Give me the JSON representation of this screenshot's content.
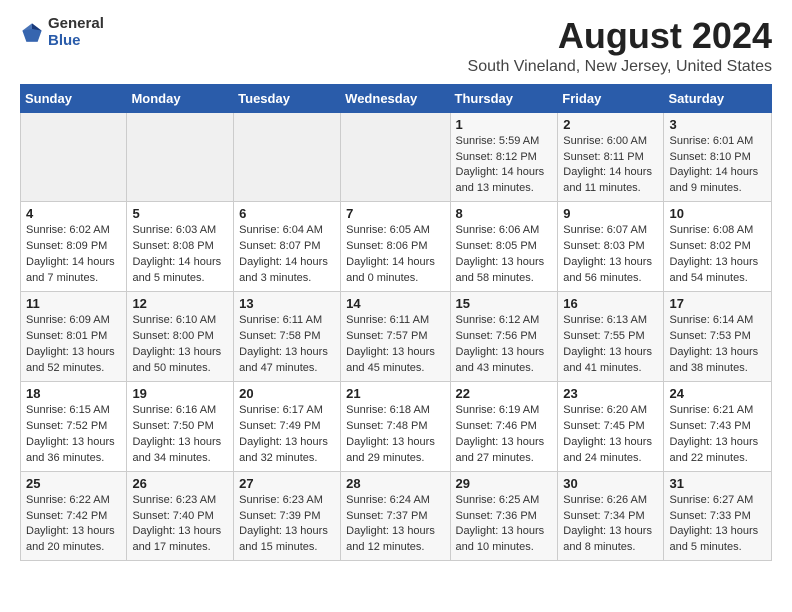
{
  "logo": {
    "general": "General",
    "blue": "Blue"
  },
  "title": "August 2024",
  "subtitle": "South Vineland, New Jersey, United States",
  "days_header": [
    "Sunday",
    "Monday",
    "Tuesday",
    "Wednesday",
    "Thursday",
    "Friday",
    "Saturday"
  ],
  "weeks": [
    [
      {
        "day": "",
        "info": ""
      },
      {
        "day": "",
        "info": ""
      },
      {
        "day": "",
        "info": ""
      },
      {
        "day": "",
        "info": ""
      },
      {
        "day": "1",
        "info": "Sunrise: 5:59 AM\nSunset: 8:12 PM\nDaylight: 14 hours\nand 13 minutes."
      },
      {
        "day": "2",
        "info": "Sunrise: 6:00 AM\nSunset: 8:11 PM\nDaylight: 14 hours\nand 11 minutes."
      },
      {
        "day": "3",
        "info": "Sunrise: 6:01 AM\nSunset: 8:10 PM\nDaylight: 14 hours\nand 9 minutes."
      }
    ],
    [
      {
        "day": "4",
        "info": "Sunrise: 6:02 AM\nSunset: 8:09 PM\nDaylight: 14 hours\nand 7 minutes."
      },
      {
        "day": "5",
        "info": "Sunrise: 6:03 AM\nSunset: 8:08 PM\nDaylight: 14 hours\nand 5 minutes."
      },
      {
        "day": "6",
        "info": "Sunrise: 6:04 AM\nSunset: 8:07 PM\nDaylight: 14 hours\nand 3 minutes."
      },
      {
        "day": "7",
        "info": "Sunrise: 6:05 AM\nSunset: 8:06 PM\nDaylight: 14 hours\nand 0 minutes."
      },
      {
        "day": "8",
        "info": "Sunrise: 6:06 AM\nSunset: 8:05 PM\nDaylight: 13 hours\nand 58 minutes."
      },
      {
        "day": "9",
        "info": "Sunrise: 6:07 AM\nSunset: 8:03 PM\nDaylight: 13 hours\nand 56 minutes."
      },
      {
        "day": "10",
        "info": "Sunrise: 6:08 AM\nSunset: 8:02 PM\nDaylight: 13 hours\nand 54 minutes."
      }
    ],
    [
      {
        "day": "11",
        "info": "Sunrise: 6:09 AM\nSunset: 8:01 PM\nDaylight: 13 hours\nand 52 minutes."
      },
      {
        "day": "12",
        "info": "Sunrise: 6:10 AM\nSunset: 8:00 PM\nDaylight: 13 hours\nand 50 minutes."
      },
      {
        "day": "13",
        "info": "Sunrise: 6:11 AM\nSunset: 7:58 PM\nDaylight: 13 hours\nand 47 minutes."
      },
      {
        "day": "14",
        "info": "Sunrise: 6:11 AM\nSunset: 7:57 PM\nDaylight: 13 hours\nand 45 minutes."
      },
      {
        "day": "15",
        "info": "Sunrise: 6:12 AM\nSunset: 7:56 PM\nDaylight: 13 hours\nand 43 minutes."
      },
      {
        "day": "16",
        "info": "Sunrise: 6:13 AM\nSunset: 7:55 PM\nDaylight: 13 hours\nand 41 minutes."
      },
      {
        "day": "17",
        "info": "Sunrise: 6:14 AM\nSunset: 7:53 PM\nDaylight: 13 hours\nand 38 minutes."
      }
    ],
    [
      {
        "day": "18",
        "info": "Sunrise: 6:15 AM\nSunset: 7:52 PM\nDaylight: 13 hours\nand 36 minutes."
      },
      {
        "day": "19",
        "info": "Sunrise: 6:16 AM\nSunset: 7:50 PM\nDaylight: 13 hours\nand 34 minutes."
      },
      {
        "day": "20",
        "info": "Sunrise: 6:17 AM\nSunset: 7:49 PM\nDaylight: 13 hours\nand 32 minutes."
      },
      {
        "day": "21",
        "info": "Sunrise: 6:18 AM\nSunset: 7:48 PM\nDaylight: 13 hours\nand 29 minutes."
      },
      {
        "day": "22",
        "info": "Sunrise: 6:19 AM\nSunset: 7:46 PM\nDaylight: 13 hours\nand 27 minutes."
      },
      {
        "day": "23",
        "info": "Sunrise: 6:20 AM\nSunset: 7:45 PM\nDaylight: 13 hours\nand 24 minutes."
      },
      {
        "day": "24",
        "info": "Sunrise: 6:21 AM\nSunset: 7:43 PM\nDaylight: 13 hours\nand 22 minutes."
      }
    ],
    [
      {
        "day": "25",
        "info": "Sunrise: 6:22 AM\nSunset: 7:42 PM\nDaylight: 13 hours\nand 20 minutes."
      },
      {
        "day": "26",
        "info": "Sunrise: 6:23 AM\nSunset: 7:40 PM\nDaylight: 13 hours\nand 17 minutes."
      },
      {
        "day": "27",
        "info": "Sunrise: 6:23 AM\nSunset: 7:39 PM\nDaylight: 13 hours\nand 15 minutes."
      },
      {
        "day": "28",
        "info": "Sunrise: 6:24 AM\nSunset: 7:37 PM\nDaylight: 13 hours\nand 12 minutes."
      },
      {
        "day": "29",
        "info": "Sunrise: 6:25 AM\nSunset: 7:36 PM\nDaylight: 13 hours\nand 10 minutes."
      },
      {
        "day": "30",
        "info": "Sunrise: 6:26 AM\nSunset: 7:34 PM\nDaylight: 13 hours\nand 8 minutes."
      },
      {
        "day": "31",
        "info": "Sunrise: 6:27 AM\nSunset: 7:33 PM\nDaylight: 13 hours\nand 5 minutes."
      }
    ]
  ]
}
